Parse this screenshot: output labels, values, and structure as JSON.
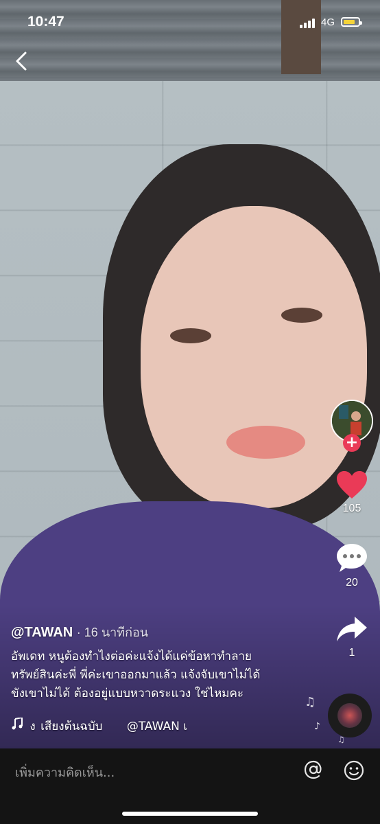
{
  "status_bar": {
    "time": "10:47",
    "network": "4G",
    "battery_color": "#f3d33a"
  },
  "nav": {
    "back_icon": "chevron-left-icon"
  },
  "side_rail": {
    "likes": "105",
    "comments": "20",
    "shares": "1",
    "like_color": "#ea3a57"
  },
  "caption": {
    "author": "@TAWAN",
    "time_ago": "· 16 นาทีก่อน",
    "description": "อัพเดท หนูต้องทำไงต่อค่ะแจ้งได้แค่ข้อหาทำลาย\nทรัพย์สินค่ะพี่ พี่ค่ะเขาออกมาแล้ว แจ้งจับเขาไม่ได้\nขังเขาไม่ได้ ต้องอยู่แบบหวาดระแวง ใช่ไหมคะ"
  },
  "music": {
    "text": "เสียงต้นฉบับ",
    "prefix_fragment": "ง",
    "author": "@TAWAN เ"
  },
  "comment_bar": {
    "placeholder": "เพิ่มความคิดเห็น..."
  }
}
